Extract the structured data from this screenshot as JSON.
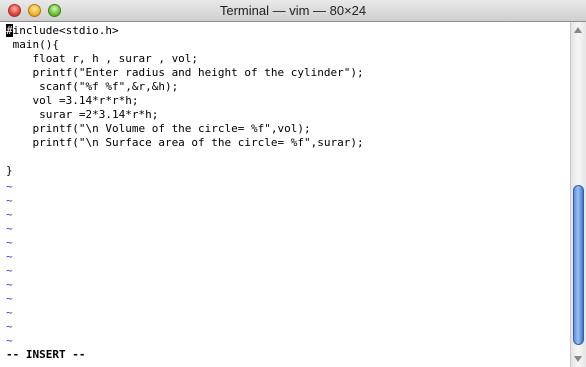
{
  "window": {
    "title": "Terminal — vim — 80×24"
  },
  "editor": {
    "first_char": "#",
    "first_rest": "include<stdio.h>",
    "code_lines": [
      " main(){",
      "    float r, h , surar , vol;",
      "    printf(\"Enter radius and height of the cylinder\");",
      "     scanf(\"%f %f\",&r,&h);",
      "    vol =3.14*r*r*h;",
      "     surar =2*3.14*r*h;",
      "    printf(\"\\n Volume of the circle= %f\",vol);",
      "    printf(\"\\n Surface area of the circle= %f\",surar);",
      "",
      "}"
    ],
    "tilde": "~",
    "status": "-- INSERT --"
  },
  "colors": {
    "tilde": "#3a3acb",
    "scroll_thumb": "#5c8fe0"
  }
}
